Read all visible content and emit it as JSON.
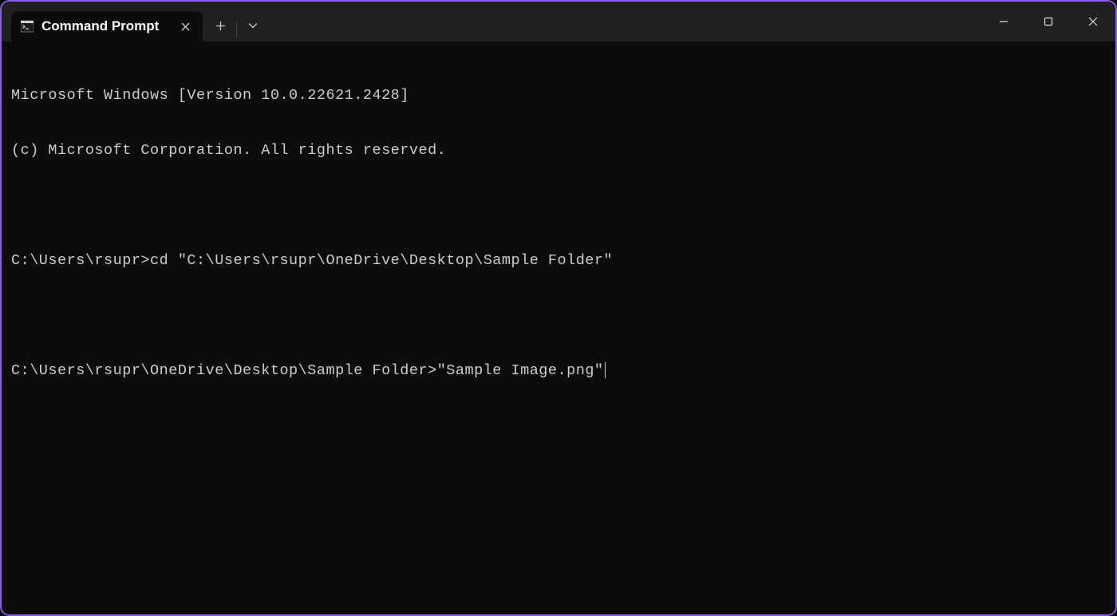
{
  "app": {
    "tab_title": "Command Prompt"
  },
  "terminal": {
    "lines": [
      "Microsoft Windows [Version 10.0.22621.2428]",
      "(c) Microsoft Corporation. All rights reserved.",
      "",
      "C:\\Users\\rsupr>cd \"C:\\Users\\rsupr\\OneDrive\\Desktop\\Sample Folder\"",
      ""
    ],
    "current_prompt": "C:\\Users\\rsupr\\OneDrive\\Desktop\\Sample Folder>",
    "current_input": "\"Sample Image.png\""
  }
}
